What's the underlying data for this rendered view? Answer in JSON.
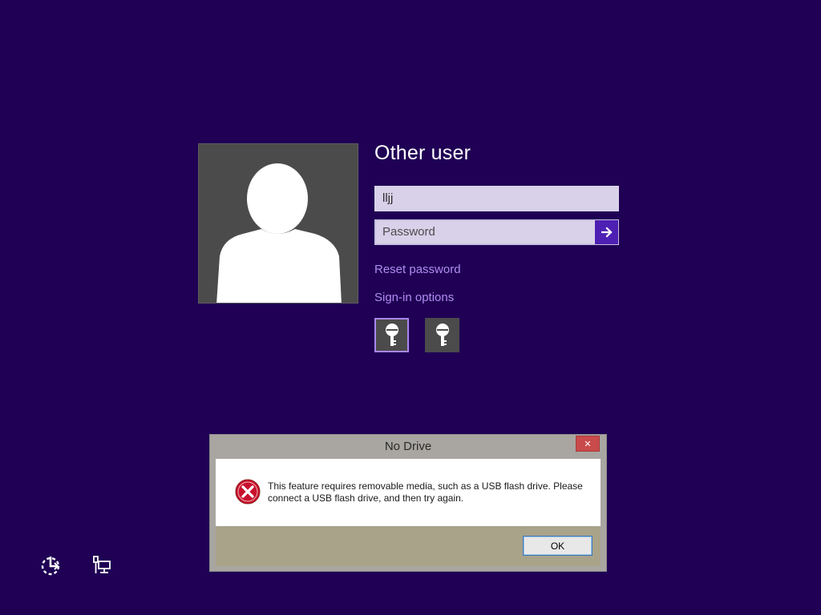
{
  "signin": {
    "username_heading": "Other user",
    "username_value": "lljj",
    "password_placeholder": "Password",
    "reset_password_link": "Reset password",
    "signin_options_link": "Sign-in options",
    "credential_icons": [
      "key-icon",
      "key-icon"
    ]
  },
  "dialog": {
    "title": "No Drive",
    "message": "This feature requires removable media, such as a USB flash drive. Please connect a USB flash drive, and then try again.",
    "ok_label": "OK",
    "close_glyph": "✕"
  },
  "system_icons": [
    "ease-of-access-icon",
    "network-icon"
  ],
  "colors": {
    "background": "#1f0054",
    "accent": "#4d1fb3",
    "link": "#b18cf2",
    "error": "#c8102e"
  }
}
